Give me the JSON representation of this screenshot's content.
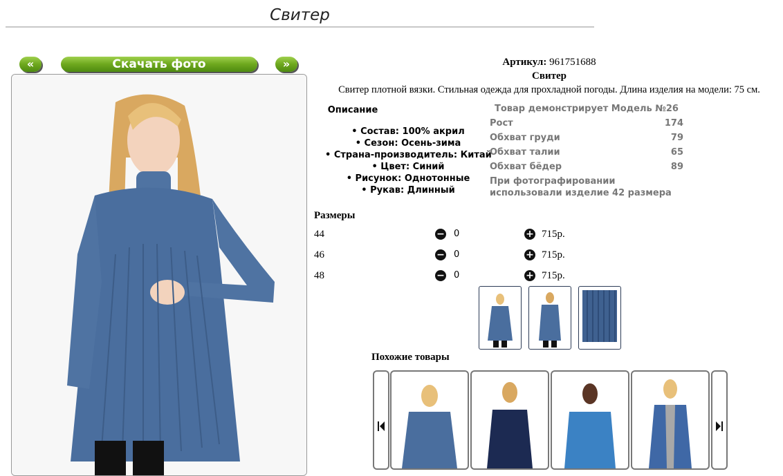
{
  "page": {
    "title": "Свитер"
  },
  "nav": {
    "prev_label": "«",
    "download_label": "Скачать фото",
    "next_label": "»"
  },
  "product": {
    "article_label": "Артикул:",
    "article_value": "961751688",
    "name": "Свитер",
    "description": "Свитер плотной вязки. Стильная одежда для прохладной погоды. Длина изделия на модели: 75 см."
  },
  "details": {
    "title": "Описание",
    "attributes": [
      "• Состав: 100% акрил",
      "• Сезон: Осень-зима",
      "• Страна-производитель: Китай",
      "• Цвет: Синий",
      "• Рисунок: Однотонные",
      "• Рукав: Длинный"
    ]
  },
  "model": {
    "title": "Товар демонстрирует Модель №26",
    "rows": [
      {
        "label": "Рост",
        "value": "174"
      },
      {
        "label": "Обхват груди",
        "value": "79"
      },
      {
        "label": "Обхват талии",
        "value": "65"
      },
      {
        "label": "Обхват бёдер",
        "value": "89"
      }
    ],
    "note": "При фотографировании использовали изделие 42 размера"
  },
  "sizes": {
    "title": "Размеры",
    "rows": [
      {
        "size": "44",
        "qty": "0",
        "price": "715р."
      },
      {
        "size": "46",
        "qty": "0",
        "price": "715р."
      },
      {
        "size": "48",
        "qty": "0",
        "price": "715р."
      }
    ],
    "minus_icon": "minus-circle-icon",
    "plus_icon": "plus-circle-icon"
  },
  "similar": {
    "title": "Похожие товары",
    "prev_icon": "skip-previous-icon",
    "next_icon": "skip-next-icon"
  },
  "colors": {
    "accent_green": "#6ea81e",
    "sweater_blue": "#4a6e9e",
    "text_gray": "#777777"
  }
}
